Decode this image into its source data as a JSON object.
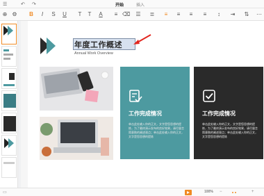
{
  "tabs": [
    {
      "label": "开始"
    },
    {
      "label": "插入"
    }
  ],
  "slide": {
    "title": "年度工作概述",
    "subtitle": "Annual Work Overview",
    "cards": [
      {
        "title": "工作完成情况",
        "body": "单击此处输入你的正文，文字是您思想的提炼，为了最终演示发布的良好效果，请尽量言简意赅的阐述观点；单击此处输入你的正文，文字是您思想的提炼"
      },
      {
        "title": "工作完成情况",
        "body": "单击此处输入你的正文，文字是您思想的提炼，为了最终演示发布的良好效果，请尽量言简意赅的阐述观点；单击此处输入你的正文，文字是您思想的提炼"
      }
    ]
  },
  "status": {
    "zoom": "100%"
  },
  "colors": {
    "accent": "#f08a24",
    "teal": "#4d9aa0",
    "dark": "#2a2a2a"
  }
}
